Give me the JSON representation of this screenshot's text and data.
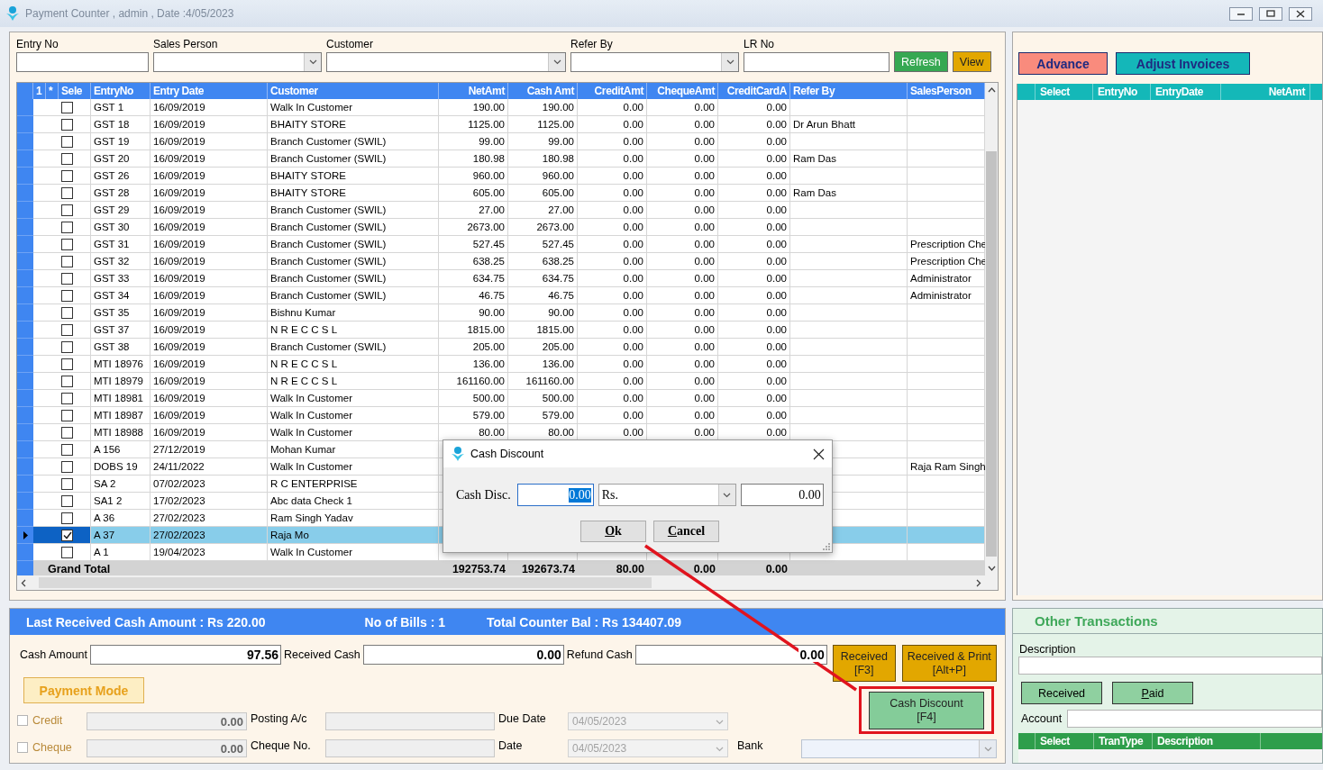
{
  "window": {
    "title": "Payment Counter , admin , Date :4/05/2023"
  },
  "filters": [
    {
      "label": "Entry No",
      "kind": "text"
    },
    {
      "label": "Sales Person",
      "kind": "combo"
    },
    {
      "label": "Customer",
      "kind": "combo"
    },
    {
      "label": "Refer By",
      "kind": "combo"
    },
    {
      "label": "LR No",
      "kind": "text"
    }
  ],
  "filter_buttons": [
    {
      "label": "Refresh",
      "color": "#36a852"
    },
    {
      "label": "View",
      "color": "#e2a700"
    }
  ],
  "table": {
    "header_marks": [
      "1",
      "*"
    ],
    "columns": [
      "Sele",
      "EntryNo",
      "Entry Date",
      "Customer",
      "NetAmt",
      "Cash  Amt",
      "CreditAmt",
      "ChequeAmt",
      "CreditCardA",
      "Refer By",
      "SalesPerson"
    ],
    "rows": [
      {
        "checked": false,
        "selected": false,
        "entry_no": "GST 1",
        "entry_date": "16/09/2019",
        "customer": "Walk In Customer",
        "net_amt": "190.00",
        "cash_amt": "190.00",
        "credit_amt": "0.00",
        "cheque_amt": "0.00",
        "card_amt": "0.00"
      },
      {
        "checked": false,
        "selected": false,
        "entry_no": "GST 18",
        "entry_date": "16/09/2019",
        "customer": "BHAITY STORE",
        "net_amt": "1125.00",
        "cash_amt": "1125.00",
        "credit_amt": "0.00",
        "cheque_amt": "0.00",
        "card_amt": "0.00",
        "refer_by": "Dr Arun Bhatt"
      },
      {
        "checked": false,
        "selected": false,
        "entry_no": "GST 19",
        "entry_date": "16/09/2019",
        "customer": "Branch Customer (SWIL)",
        "net_amt": "99.00",
        "cash_amt": "99.00",
        "credit_amt": "0.00",
        "cheque_amt": "0.00",
        "card_amt": "0.00"
      },
      {
        "checked": false,
        "selected": false,
        "entry_no": "GST 20",
        "entry_date": "16/09/2019",
        "customer": "Branch Customer (SWIL)",
        "net_amt": "180.98",
        "cash_amt": "180.98",
        "credit_amt": "0.00",
        "cheque_amt": "0.00",
        "card_amt": "0.00",
        "refer_by": "Ram Das"
      },
      {
        "checked": false,
        "selected": false,
        "entry_no": "GST 26",
        "entry_date": "16/09/2019",
        "customer": "BHAITY STORE",
        "net_amt": "960.00",
        "cash_amt": "960.00",
        "credit_amt": "0.00",
        "cheque_amt": "0.00",
        "card_amt": "0.00"
      },
      {
        "checked": false,
        "selected": false,
        "entry_no": "GST 28",
        "entry_date": "16/09/2019",
        "customer": "BHAITY STORE",
        "net_amt": "605.00",
        "cash_amt": "605.00",
        "credit_amt": "0.00",
        "cheque_amt": "0.00",
        "card_amt": "0.00",
        "refer_by": "Ram Das"
      },
      {
        "checked": false,
        "selected": false,
        "entry_no": "GST 29",
        "entry_date": "16/09/2019",
        "customer": "Branch Customer (SWIL)",
        "net_amt": "27.00",
        "cash_amt": "27.00",
        "credit_amt": "0.00",
        "cheque_amt": "0.00",
        "card_amt": "0.00"
      },
      {
        "checked": false,
        "selected": false,
        "entry_no": "GST 30",
        "entry_date": "16/09/2019",
        "customer": "Branch Customer (SWIL)",
        "net_amt": "2673.00",
        "cash_amt": "2673.00",
        "credit_amt": "0.00",
        "cheque_amt": "0.00",
        "card_amt": "0.00"
      },
      {
        "checked": false,
        "selected": false,
        "entry_no": "GST 31",
        "entry_date": "16/09/2019",
        "customer": "Branch Customer (SWIL)",
        "net_amt": "527.45",
        "cash_amt": "527.45",
        "credit_amt": "0.00",
        "cheque_amt": "0.00",
        "card_amt": "0.00",
        "sales_person": "Prescription Che"
      },
      {
        "checked": false,
        "selected": false,
        "entry_no": "GST 32",
        "entry_date": "16/09/2019",
        "customer": "Branch Customer (SWIL)",
        "net_amt": "638.25",
        "cash_amt": "638.25",
        "credit_amt": "0.00",
        "cheque_amt": "0.00",
        "card_amt": "0.00",
        "sales_person": "Prescription Che"
      },
      {
        "checked": false,
        "selected": false,
        "entry_no": "GST 33",
        "entry_date": "16/09/2019",
        "customer": "Branch Customer (SWIL)",
        "net_amt": "634.75",
        "cash_amt": "634.75",
        "credit_amt": "0.00",
        "cheque_amt": "0.00",
        "card_amt": "0.00",
        "sales_person": "Administrator"
      },
      {
        "checked": false,
        "selected": false,
        "entry_no": "GST 34",
        "entry_date": "16/09/2019",
        "customer": "Branch Customer (SWIL)",
        "net_amt": "46.75",
        "cash_amt": "46.75",
        "credit_amt": "0.00",
        "cheque_amt": "0.00",
        "card_amt": "0.00",
        "sales_person": "Administrator"
      },
      {
        "checked": false,
        "selected": false,
        "entry_no": "GST 35",
        "entry_date": "16/09/2019",
        "customer": "Bishnu Kumar",
        "net_amt": "90.00",
        "cash_amt": "90.00",
        "credit_amt": "0.00",
        "cheque_amt": "0.00",
        "card_amt": "0.00"
      },
      {
        "checked": false,
        "selected": false,
        "entry_no": "GST 37",
        "entry_date": "16/09/2019",
        "customer": "N R E C C S L",
        "net_amt": "1815.00",
        "cash_amt": "1815.00",
        "credit_amt": "0.00",
        "cheque_amt": "0.00",
        "card_amt": "0.00"
      },
      {
        "checked": false,
        "selected": false,
        "entry_no": "GST 38",
        "entry_date": "16/09/2019",
        "customer": "Branch Customer (SWIL)",
        "net_amt": "205.00",
        "cash_amt": "205.00",
        "credit_amt": "0.00",
        "cheque_amt": "0.00",
        "card_amt": "0.00"
      },
      {
        "checked": false,
        "selected": false,
        "entry_no": "MTI 18976",
        "entry_date": "16/09/2019",
        "customer": "N R E C C S L",
        "net_amt": "136.00",
        "cash_amt": "136.00",
        "credit_amt": "0.00",
        "cheque_amt": "0.00",
        "card_amt": "0.00"
      },
      {
        "checked": false,
        "selected": false,
        "entry_no": "MTI 18979",
        "entry_date": "16/09/2019",
        "customer": "N R E C C S L",
        "net_amt": "161160.00",
        "cash_amt": "161160.00",
        "credit_amt": "0.00",
        "cheque_amt": "0.00",
        "card_amt": "0.00"
      },
      {
        "checked": false,
        "selected": false,
        "entry_no": "MTI 18981",
        "entry_date": "16/09/2019",
        "customer": "Walk In Customer",
        "net_amt": "500.00",
        "cash_amt": "500.00",
        "credit_amt": "0.00",
        "cheque_amt": "0.00",
        "card_amt": "0.00"
      },
      {
        "checked": false,
        "selected": false,
        "entry_no": "MTI 18987",
        "entry_date": "16/09/2019",
        "customer": "Walk In Customer",
        "net_amt": "579.00",
        "cash_amt": "579.00",
        "credit_amt": "0.00",
        "cheque_amt": "0.00",
        "card_amt": "0.00"
      },
      {
        "checked": false,
        "selected": false,
        "entry_no": "MTI 18988",
        "entry_date": "16/09/2019",
        "customer": "Walk In Customer",
        "net_amt": "80.00",
        "cash_amt": "80.00",
        "credit_amt": "0.00",
        "cheque_amt": "0.00",
        "card_amt": "0.00"
      },
      {
        "checked": false,
        "selected": false,
        "entry_no": "A 156",
        "entry_date": "27/12/2019",
        "customer": "Mohan Kumar"
      },
      {
        "checked": false,
        "selected": false,
        "entry_no": "DOBS 19",
        "entry_date": "24/11/2022",
        "customer": "Walk In Customer",
        "sales_person": "Raja Ram Singh"
      },
      {
        "checked": false,
        "selected": false,
        "entry_no": "SA 2",
        "entry_date": "07/02/2023",
        "customer": "R C ENTERPRISE"
      },
      {
        "checked": false,
        "selected": false,
        "entry_no": "SA1 2",
        "entry_date": "17/02/2023",
        "customer": "Abc data Check 1"
      },
      {
        "checked": false,
        "selected": false,
        "entry_no": "A 36",
        "entry_date": "27/02/2023",
        "customer": "Ram Singh Yadav"
      },
      {
        "checked": true,
        "selected": true,
        "entry_no": "A 37",
        "entry_date": "27/02/2023",
        "customer": "Raja Mo"
      },
      {
        "checked": false,
        "selected": false,
        "entry_no": "A 1",
        "entry_date": "19/04/2023",
        "customer": "Walk In Customer"
      }
    ],
    "grand_total": {
      "label": "Grand Total",
      "values": [
        "192753.74",
        "192673.74",
        "80.00",
        "0.00",
        "0.00"
      ]
    }
  },
  "dialog": {
    "title": "Cash Discount",
    "label": "Cash Disc.",
    "value": "0.00",
    "unit": "Rs.",
    "result": "0.00",
    "buttons": [
      "Ok",
      "Cancel"
    ]
  },
  "summary_bar": [
    "Last Received Cash Amount : Rs 220.00",
    "No of Bills :  1",
    "Total Counter Bal : Rs 134407.09"
  ],
  "payment": {
    "fields": [
      {
        "label": "Cash Amount",
        "value": "97.56"
      },
      {
        "label": "Received Cash",
        "value": "0.00"
      },
      {
        "label": "Refund Cash",
        "value": "0.00"
      }
    ],
    "actions": [
      {
        "label": "Received",
        "shortcut": "[F3]"
      },
      {
        "label": "Received & Print",
        "shortcut": "[Alt+P]"
      }
    ],
    "payment_mode": "Payment Mode",
    "modes": [
      {
        "label": "Credit",
        "checked": false,
        "amount": "0.00",
        "field_label": "Posting A/c",
        "date_label": "Due Date",
        "date": "04/05/2023"
      },
      {
        "label": "Cheque",
        "checked": false,
        "amount": "0.00",
        "field_label": "Cheque No.",
        "date_label": "Date",
        "date": "04/05/2023",
        "extra_label": "Bank"
      }
    ],
    "cash_discount": {
      "label": "Cash Discount",
      "shortcut": "[F4]"
    }
  },
  "invoices_panel": {
    "buttons": [
      {
        "label": "Advance",
        "color": "#f98b7d"
      },
      {
        "label": "Adjust Invoices",
        "color": "#14b7b9"
      }
    ],
    "columns": [
      "Select",
      "EntryNo",
      "EntryDate",
      "NetAmt"
    ]
  },
  "other_transactions": {
    "title": "Other Transactions",
    "description_label": "Description",
    "buttons": [
      "Received",
      "Paid"
    ],
    "account_label": "Account",
    "columns": [
      "Select",
      "TranType",
      "Description"
    ]
  }
}
